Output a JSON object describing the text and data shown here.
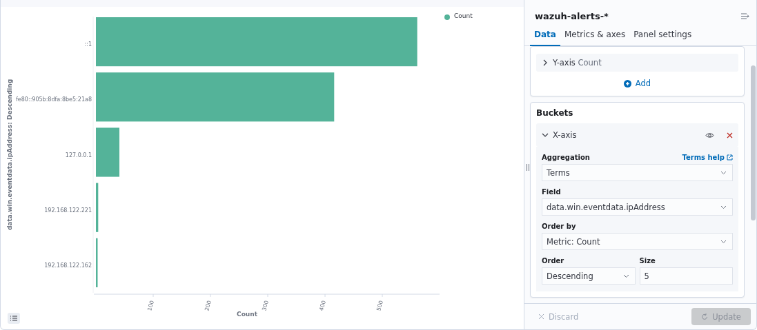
{
  "chart": {
    "chart_data": {
      "type": "bar",
      "orientation": "horizontal",
      "xlabel": "Count",
      "ylabel": "data.win.eventdata.ipAddress: Descending",
      "categories": [
        "::1",
        "fe80::905b:8dfa:8be5:21a8",
        "127.0.0.1",
        "192.168.122.221",
        "192.168.122.162"
      ],
      "series": [
        {
          "name": "Count",
          "color": "#54b399",
          "values": [
            561,
            416,
            41,
            4,
            3
          ]
        }
      ],
      "xlim": [
        0,
        600
      ],
      "xticks": [
        100,
        200,
        300,
        400,
        500
      ]
    }
  },
  "editor": {
    "title": "wazuh-alerts-*",
    "tabs": [
      {
        "label": "Data",
        "selected": true
      },
      {
        "label": "Metrics & axes",
        "selected": false
      },
      {
        "label": "Panel settings",
        "selected": false
      }
    ],
    "metrics": {
      "items": [
        {
          "label": "Y-axis",
          "value": "Count",
          "expanded": false
        }
      ],
      "add_label": "Add"
    },
    "buckets": {
      "title": "Buckets",
      "item": {
        "label": "X-axis",
        "expanded": true,
        "help_link": "Terms help",
        "fields": [
          {
            "label": "Aggregation",
            "value": "Terms",
            "kind": "select"
          },
          {
            "label": "Field",
            "value": "data.win.eventdata.ipAddress",
            "kind": "select"
          },
          {
            "label": "Order by",
            "value": "Metric: Count",
            "kind": "select"
          }
        ],
        "pair": [
          {
            "label": "Order",
            "value": "Descending",
            "kind": "select"
          },
          {
            "label": "Size",
            "value": "5",
            "kind": "input"
          }
        ]
      }
    },
    "footer": {
      "discard": "Discard",
      "update": "Update",
      "update_disabled": true
    }
  }
}
